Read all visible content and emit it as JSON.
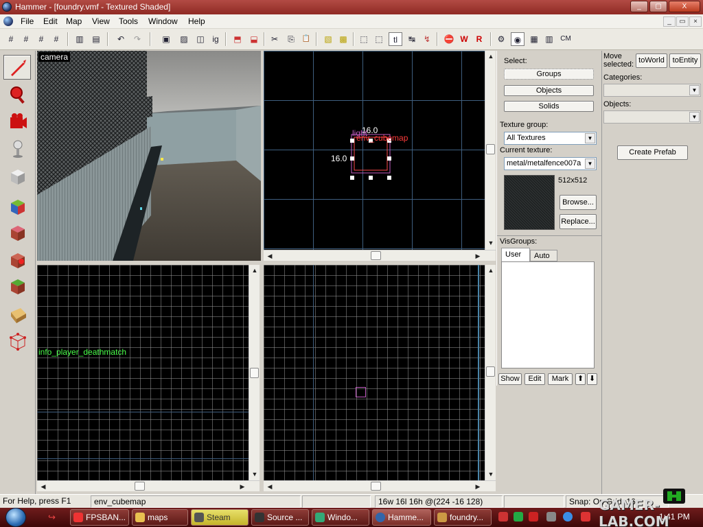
{
  "window": {
    "title": "Hammer - [foundry.vmf - Textured Shaded]",
    "minimize": "_",
    "maximize": "▢",
    "close": "X"
  },
  "menu": {
    "items": [
      "File",
      "Edit",
      "Map",
      "View",
      "Tools",
      "Window",
      "Help"
    ],
    "doc_minimize": "_",
    "doc_restore": "▭",
    "doc_close": "×"
  },
  "toolbar": {
    "icons": [
      {
        "name": "grid-toggle-icon",
        "glyph": "#"
      },
      {
        "name": "grid-smaller-icon",
        "glyph": "#"
      },
      {
        "name": "grid-larger-icon",
        "glyph": "#"
      },
      {
        "name": "grid-3d-icon",
        "glyph": "#"
      },
      {
        "name": "load-window-state-icon",
        "glyph": "▥"
      },
      {
        "name": "save-window-state-icon",
        "glyph": "▤"
      },
      {
        "name": "undo-icon",
        "glyph": "↶"
      },
      {
        "name": "redo-icon",
        "glyph": "↷"
      },
      {
        "name": "group-icon",
        "glyph": "▣"
      },
      {
        "name": "ungroup-icon",
        "glyph": "▨"
      },
      {
        "name": "hide-items-icon",
        "glyph": "◫"
      },
      {
        "name": "ignore-grouping-icon",
        "glyph": "ig"
      },
      {
        "name": "carve-icon",
        "glyph": "⬒"
      },
      {
        "name": "hollow-icon",
        "glyph": "⬓"
      },
      {
        "name": "cut-icon",
        "glyph": "✂"
      },
      {
        "name": "copy-icon",
        "glyph": "⎘"
      },
      {
        "name": "paste-icon",
        "glyph": "📋"
      },
      {
        "name": "texture-lock-icon",
        "glyph": "▧"
      },
      {
        "name": "texture-scale-lock-icon",
        "glyph": "▩"
      },
      {
        "name": "selection-box-icon",
        "glyph": "⬚"
      },
      {
        "name": "select-by-handles-icon",
        "glyph": "⬚"
      },
      {
        "name": "toggle-text-icon",
        "glyph": "tl"
      },
      {
        "name": "toggle-helpers-icon",
        "glyph": "↹"
      },
      {
        "name": "toggle-models-icon",
        "glyph": "↯"
      },
      {
        "name": "check-map-icon",
        "glyph": "⛔"
      },
      {
        "name": "compile-map-icon",
        "glyph": "W"
      },
      {
        "name": "run-map-icon",
        "glyph": "R"
      },
      {
        "name": "entity-report-icon",
        "glyph": "⚙"
      },
      {
        "name": "toggle-cordon-icon",
        "glyph": "◉"
      },
      {
        "name": "toggle-wireframe-icon",
        "glyph": "▦"
      },
      {
        "name": "cubemap-toggle-icon",
        "glyph": "CM"
      }
    ]
  },
  "tools": [
    {
      "name": "selection-tool-icon"
    },
    {
      "name": "magnify-tool-icon"
    },
    {
      "name": "camera-tool-icon"
    },
    {
      "name": "entity-tool-icon"
    },
    {
      "name": "block-tool-icon"
    },
    {
      "name": "texture-application-icon"
    },
    {
      "name": "apply-current-texture-icon"
    },
    {
      "name": "decal-tool-icon"
    },
    {
      "name": "overlay-tool-icon"
    },
    {
      "name": "clipping-tool-icon"
    },
    {
      "name": "vertex-tool-icon"
    }
  ],
  "viewports": {
    "camera_label": "camera",
    "top_view": {
      "dimension_width": "16.0",
      "dimension_height": "16.0",
      "entity_label_light": "light",
      "entity_label_cubemap": "env_cubemap"
    },
    "side_view": {
      "entity_label": "info_player_deathmatch"
    }
  },
  "selection_panel": {
    "select_label": "Select:",
    "groups_button": "Groups",
    "objects_button": "Objects",
    "solids_button": "Solids",
    "texture_group_label": "Texture group:",
    "texture_group_value": "All Textures",
    "current_texture_label": "Current texture:",
    "current_texture_value": "metal/metalfence007a",
    "texture_size": "512x512",
    "browse_button": "Browse...",
    "replace_button": "Replace...",
    "visgroups_label": "VisGroups:",
    "tab_user": "User",
    "tab_auto": "Auto",
    "show_button": "Show",
    "edit_button": "Edit",
    "mark_button": "Mark",
    "up_button": "⬆",
    "down_button": "⬇"
  },
  "prefab_panel": {
    "move_selected_label": "Move selected:",
    "to_world_button": "toWorld",
    "to_entity_button": "toEntity",
    "categories_label": "Categories:",
    "objects_label": "Objects:",
    "create_prefab_button": "Create Prefab"
  },
  "statusbar": {
    "help": "For Help, press F1",
    "selection": "env_cubemap",
    "empty1": "",
    "size_position": "16w 16l 16h @(224 -16 128)",
    "empty2": "",
    "snap": "Snap: On Grid: 16"
  },
  "taskbar": {
    "tasks": [
      {
        "label": "FPSBAN...",
        "name": "task-fpsbanana"
      },
      {
        "label": "maps",
        "name": "task-maps-folder"
      },
      {
        "label": "Steam",
        "name": "task-steam"
      },
      {
        "label": "Source ...",
        "name": "task-source-sdk"
      },
      {
        "label": "Windo...",
        "name": "task-windows"
      },
      {
        "label": "Hamme...",
        "name": "task-hammer"
      },
      {
        "label": "foundry...",
        "name": "task-foundry"
      }
    ],
    "clock": "1:41 PM"
  },
  "watermark": "GAMER-LAB.COM",
  "colors": {
    "titlebar": "#a23a33",
    "grid_major": "#3f5f80",
    "selection_box": "#ff4a4a",
    "entity_cubemap": "#ff6b8a",
    "entity_player": "#4aff4a",
    "taskbar": "#5a1010"
  }
}
